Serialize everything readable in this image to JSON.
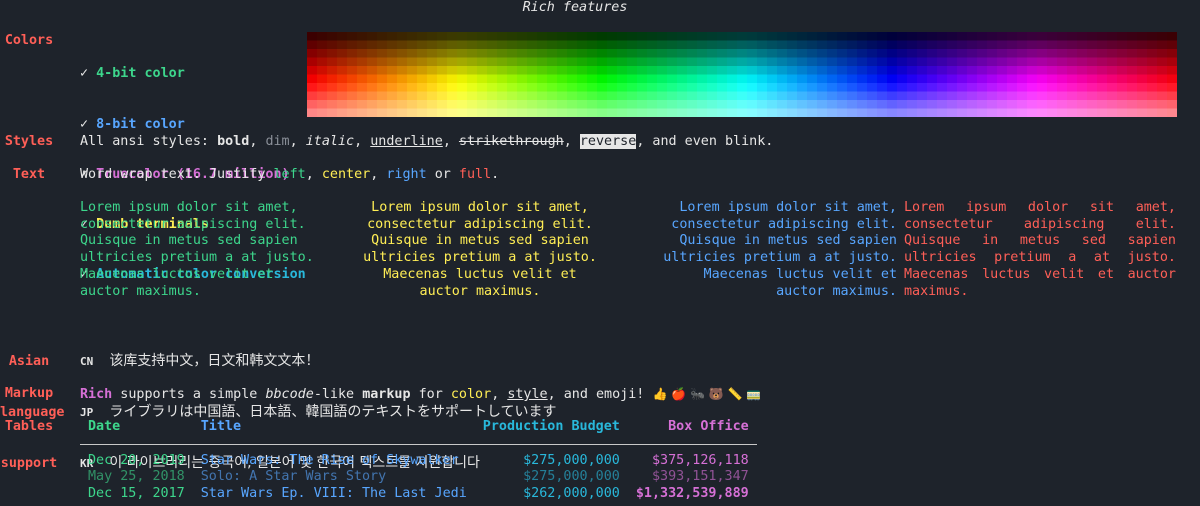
{
  "title": "Rich features",
  "sections": {
    "colors": "Colors",
    "styles": "Styles",
    "text": "Text",
    "asian": [
      "Asian",
      "language",
      "support"
    ],
    "markup": "Markup",
    "tables": "Tables"
  },
  "colors_list": {
    "check": "✓",
    "items": [
      "4-bit color",
      "8-bit color",
      "Truecolor (16.7 million)",
      "Dumb terminals",
      "Automatic color conversion"
    ]
  },
  "styles_line": {
    "prefix": "All ansi styles: ",
    "bold": "bold",
    "dim": "dim",
    "italic": "italic",
    "underline": "underline",
    "strikethrough": "strikethrough",
    "reverse": "reverse",
    "sep": ", ",
    "suffix": ", and even blink."
  },
  "text_line": {
    "prefix": "Word wrap text. Justify ",
    "left": "left",
    "center": "center",
    "right": "right",
    "or": " or ",
    "full": "full",
    "end": "."
  },
  "lorem": "Lorem ipsum dolor sit amet, consectetur adipiscing elit. Quisque in metus sed sapien ultricies pretium a at justo. Maecenas luctus velit et auctor maximus.",
  "asian_rows": [
    {
      "code": "CN",
      "text": "该库支持中文，日文和韩文文本！"
    },
    {
      "code": "JP",
      "text": "ライブラリは中国語、日本語、韓国語のテキストをサポートしています"
    },
    {
      "code": "KR",
      "text": "이 라이브러리는 중국어, 일본어 및 한국어 텍스트를 지원합니다"
    }
  ],
  "markup_line": {
    "rich": "Rich",
    "t1": " supports a simple ",
    "bbcode": "bbcode",
    "t2": "-like ",
    "markup": "markup",
    "t3": " for ",
    "color": "color",
    "t4": ", ",
    "style": "style",
    "t5": ", and emoji! ",
    "emoji": "👍 🍎 🐜 🐻 📏 🚃"
  },
  "table": {
    "headers": [
      "Date",
      "Title",
      "Production Budget",
      "Box Office"
    ],
    "rows": [
      {
        "date": "Dec 20, 2019",
        "title": "Star Wars: The Rise of Skywalker",
        "budget": "$275,000,000",
        "box": "$375,126,118"
      },
      {
        "date": "May 25, 2018",
        "title": "Solo: A Star Wars Story",
        "budget": "$275,000,000",
        "box": "$393,151,347"
      },
      {
        "date": "Dec 15, 2017",
        "title": "Star Wars Ep. VIII: The Last Jedi",
        "budget": "$262,000,000",
        "box": "$1,332,539,889"
      }
    ]
  }
}
